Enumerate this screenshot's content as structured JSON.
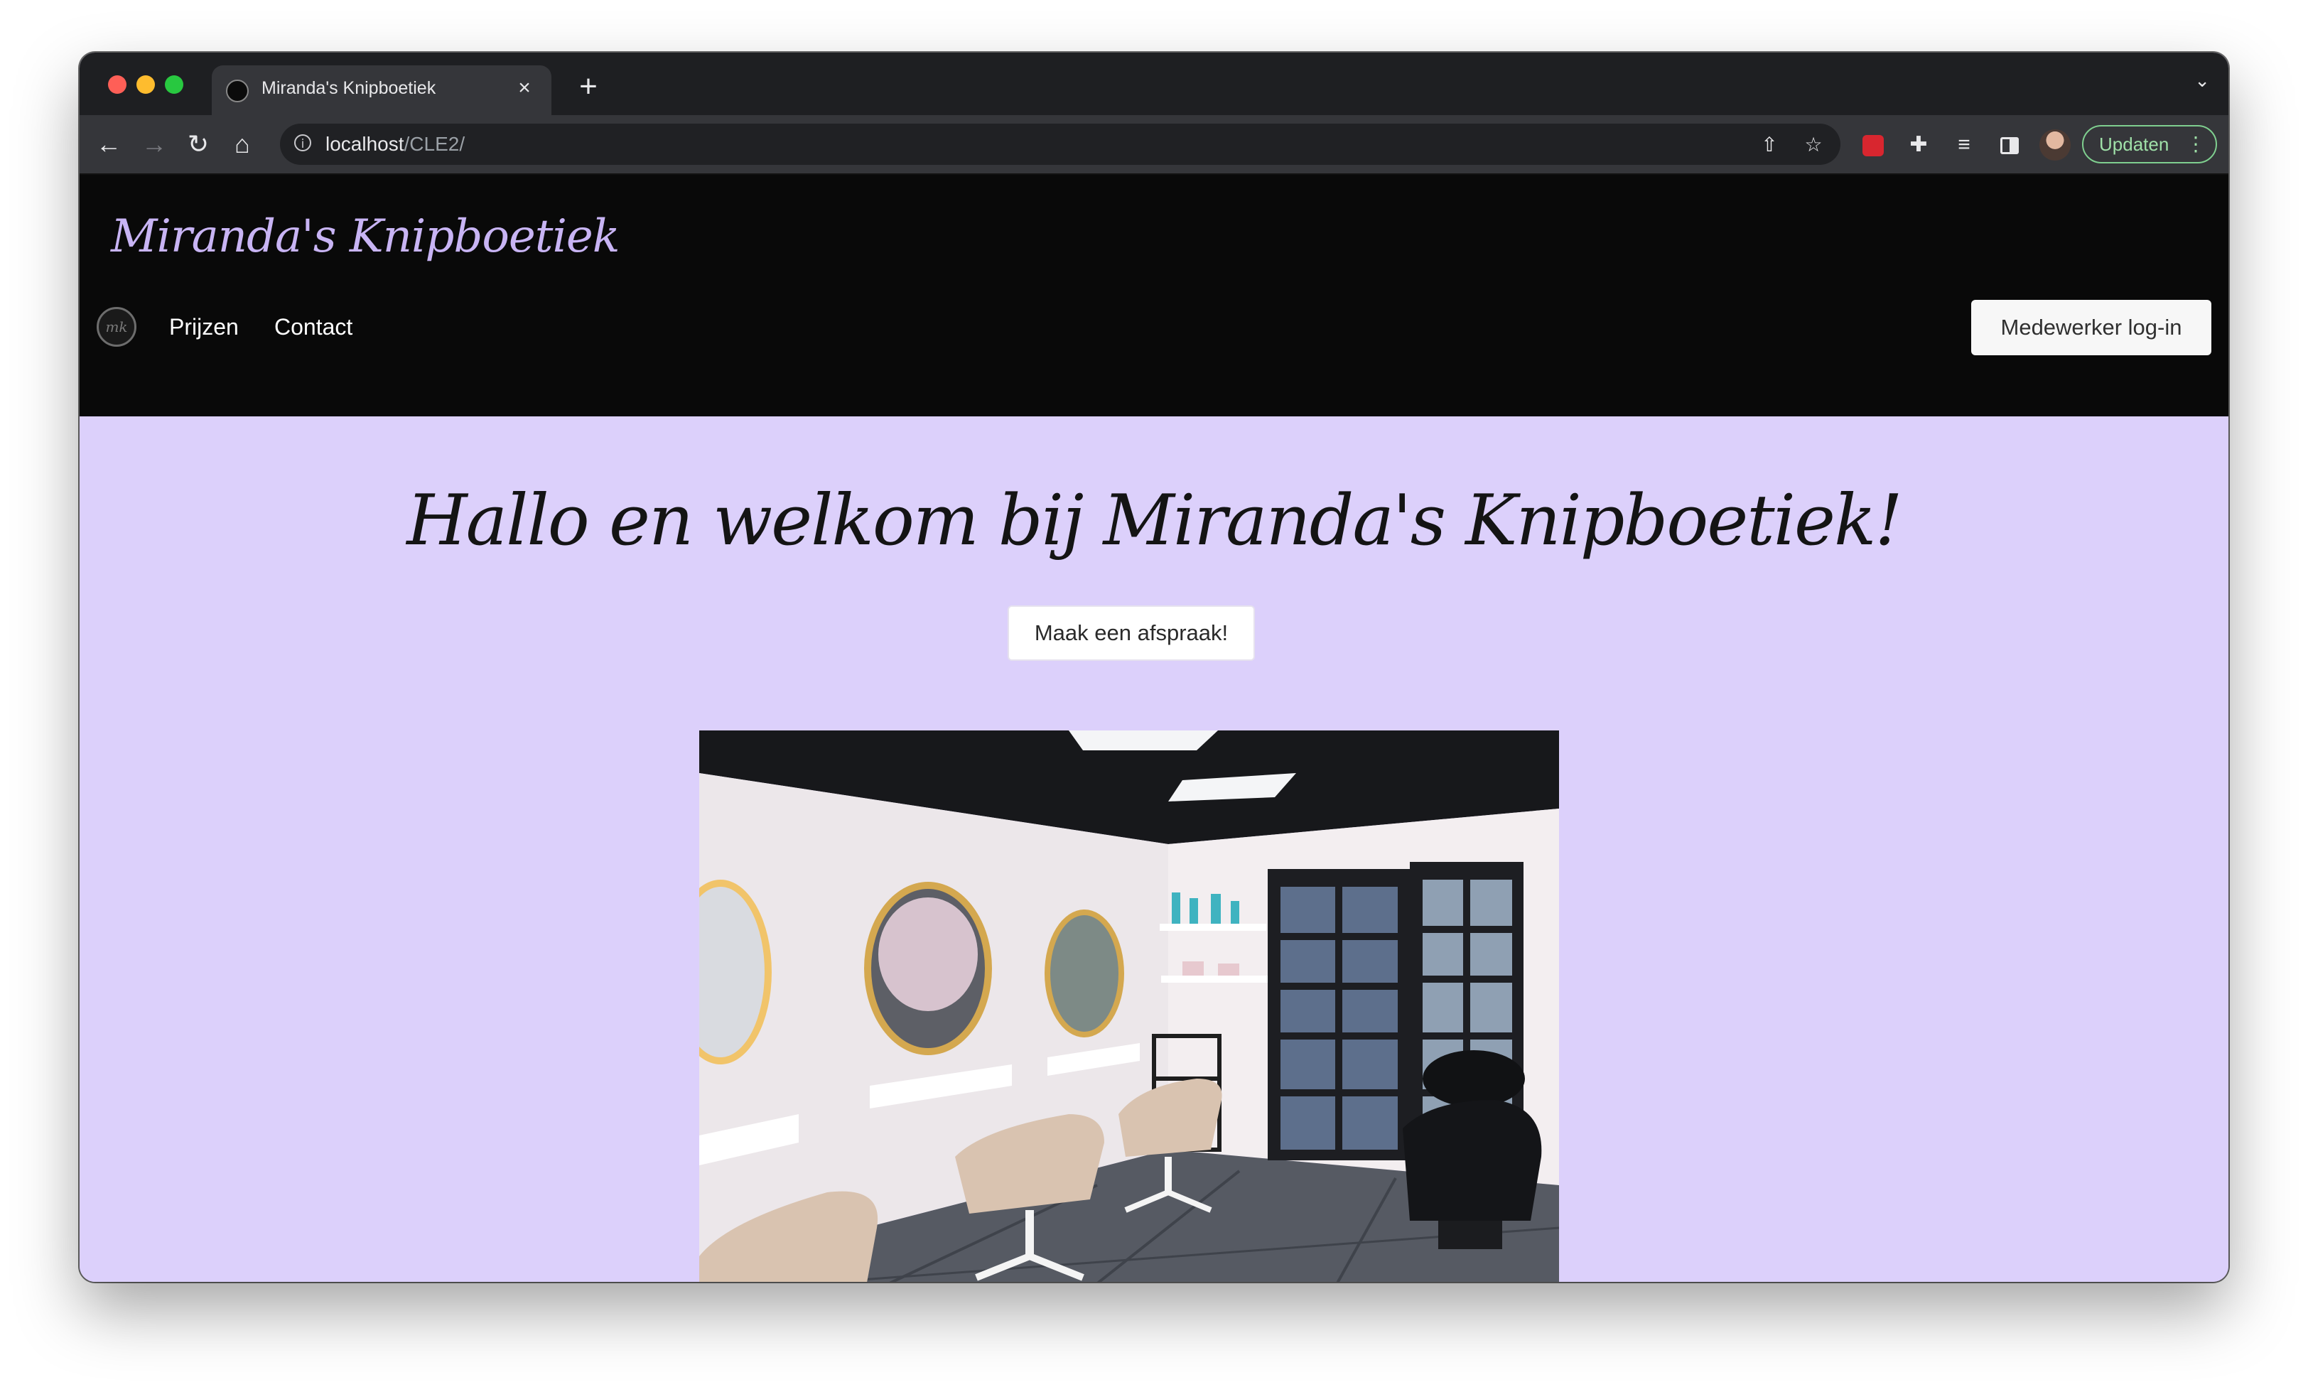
{
  "browser": {
    "tab_title": "Miranda's Knipboetiek",
    "tab_close": "×",
    "new_tab": "+",
    "tabs_menu": "⌄",
    "url_host": "localhost",
    "url_path": "/CLE2/",
    "update_label": "Updaten",
    "kebab": "⋮"
  },
  "site": {
    "brand": "Miranda's Knipboetiek",
    "logo_text": "mk",
    "nav": {
      "prijzen": "Prijzen",
      "contact": "Contact"
    },
    "login_button": "Medewerker log-in"
  },
  "hero": {
    "title": "Hallo en welkom bij Miranda's Knipboetiek!",
    "appointment_button": "Maak een afspraak!"
  },
  "colors": {
    "header_bg": "#090909",
    "brand_color": "#c8b4f4",
    "page_bg": "#dcd0fb",
    "chrome_bg": "#35363a"
  }
}
